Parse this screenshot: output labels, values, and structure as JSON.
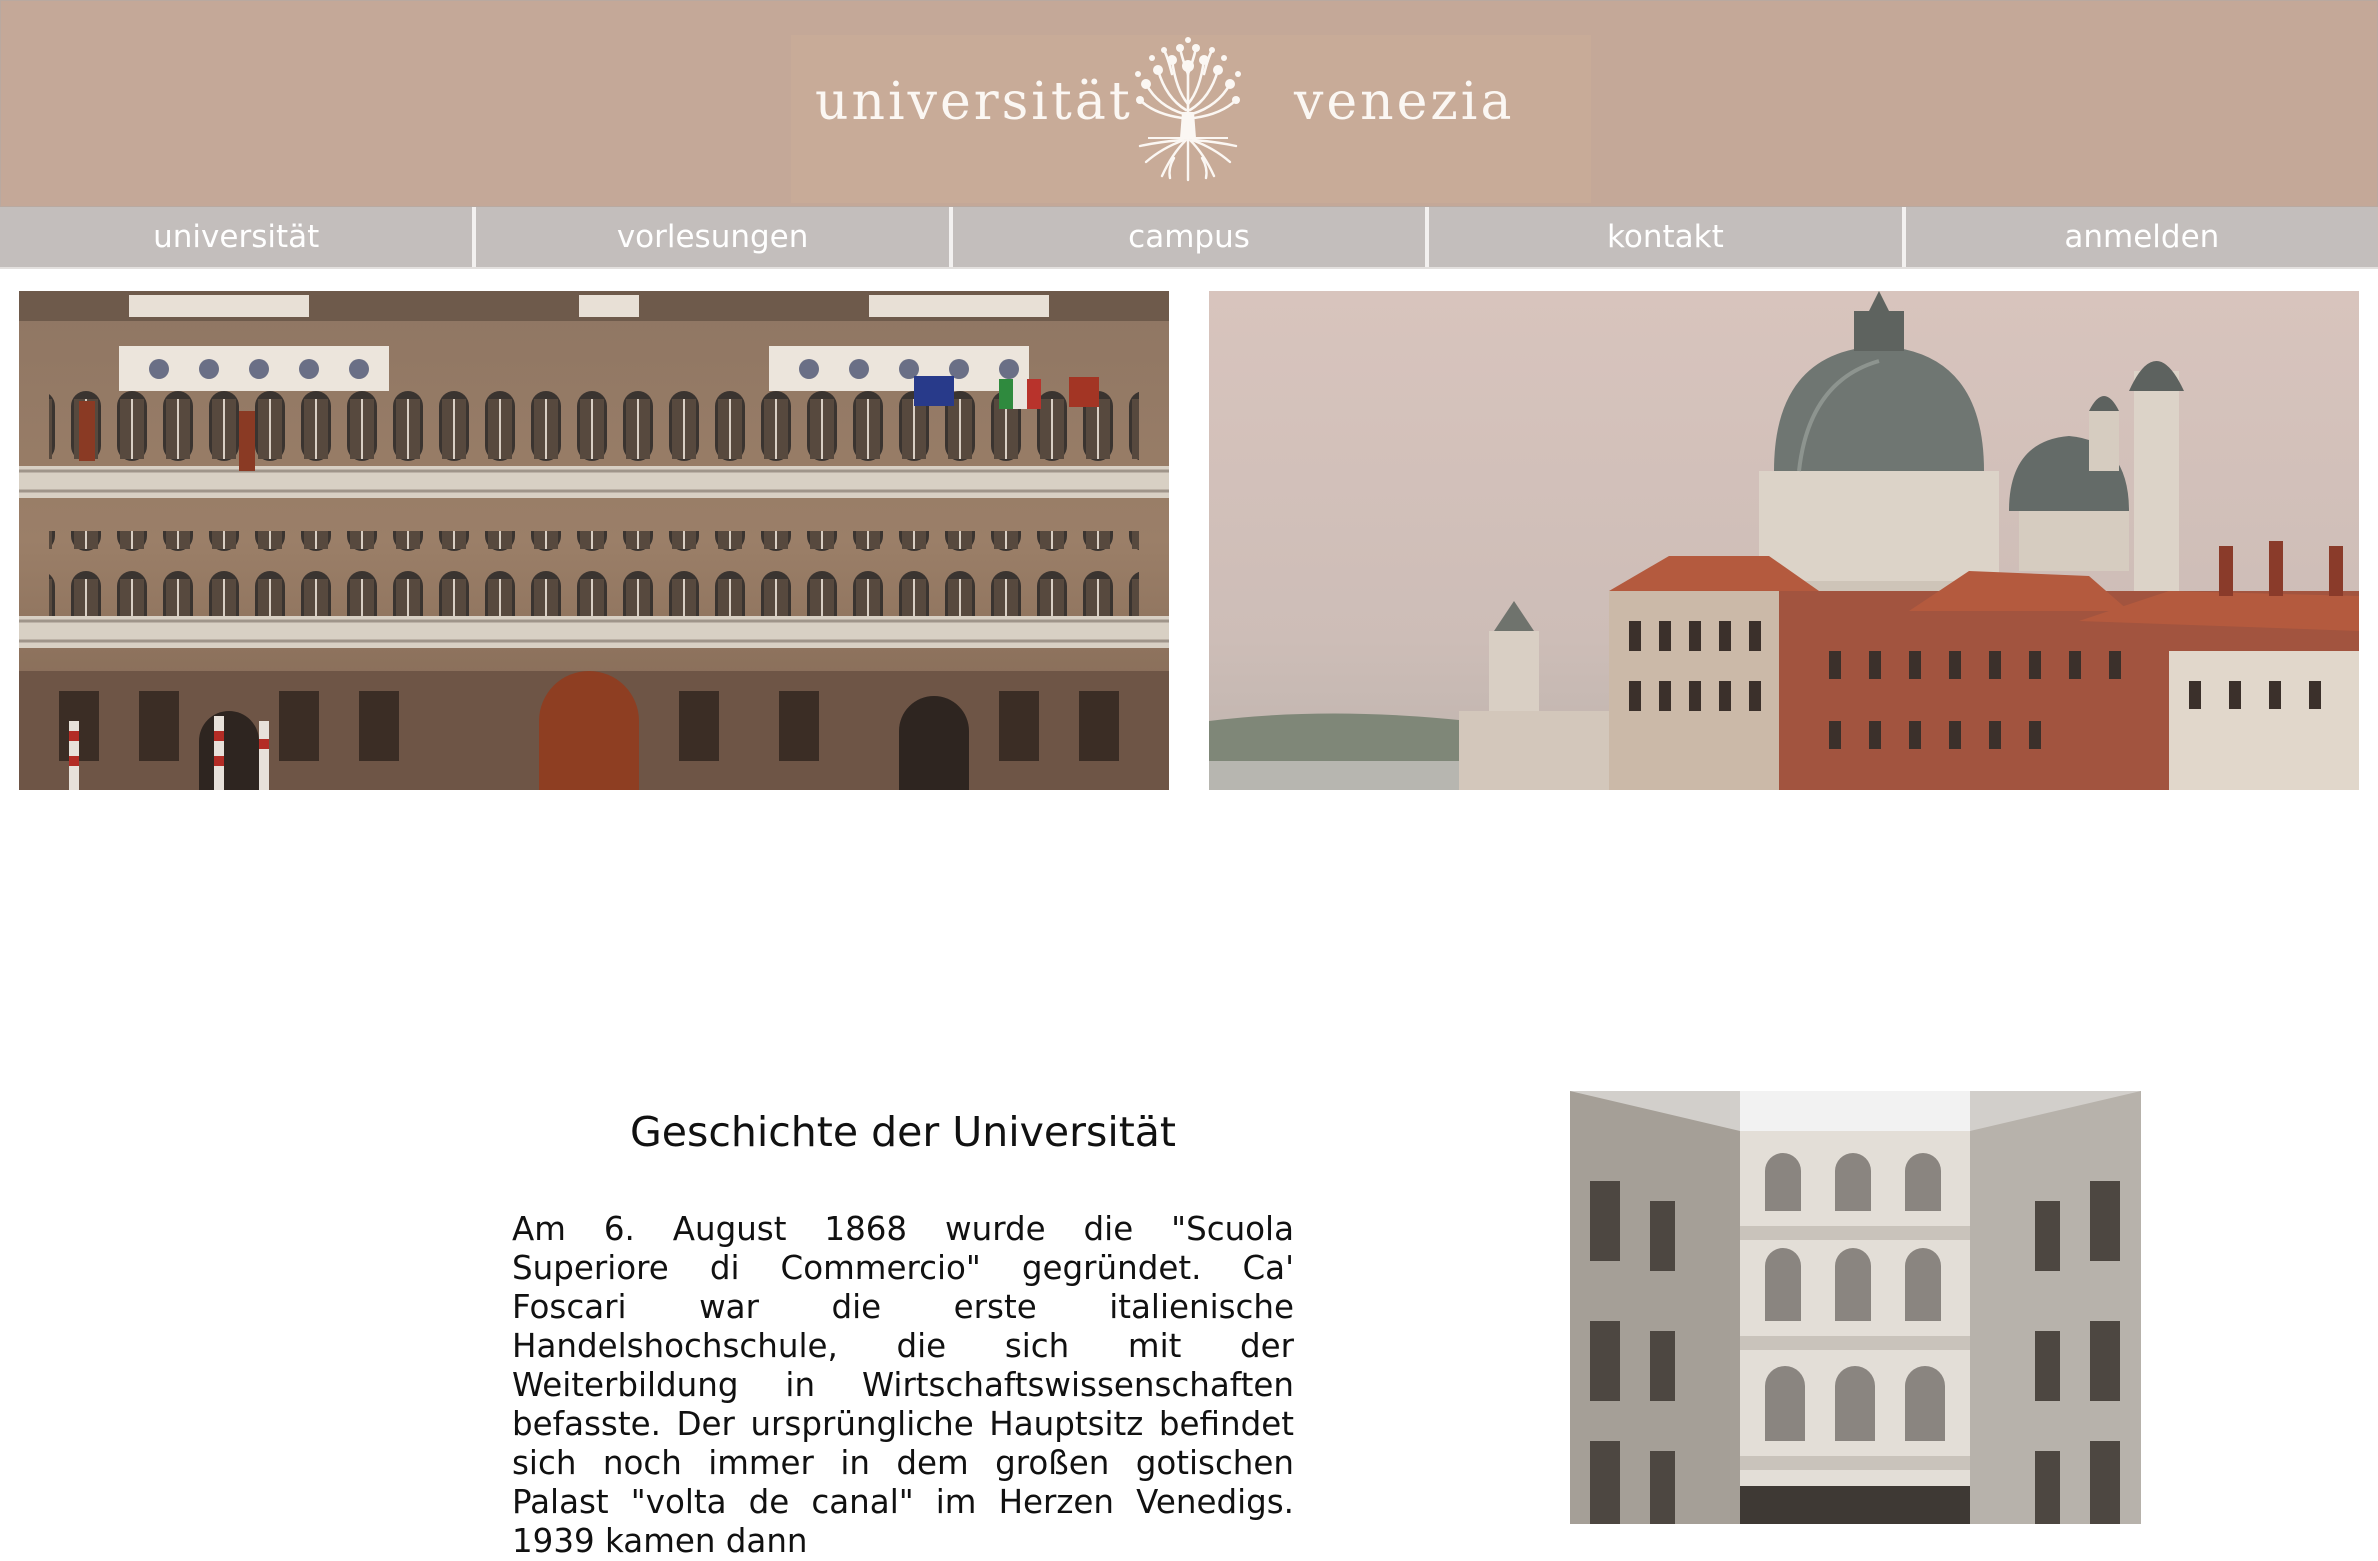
{
  "header": {
    "logo_left": "universität",
    "logo_right": "venezia",
    "logo_icon": "tree-icon"
  },
  "nav": {
    "items": [
      {
        "label": "universität"
      },
      {
        "label": "vorlesungen"
      },
      {
        "label": "campus"
      },
      {
        "label": "kontakt"
      },
      {
        "label": "anmelden"
      }
    ]
  },
  "hero": {
    "left_image": "palazzo-facade-photo",
    "right_image": "santa-maria-della-salute-photo"
  },
  "history": {
    "title": "Geschichte der Universität",
    "text": "Am 6. August 1868 wurde die \"Scuola Superiore di Commercio\" gegründet. Ca' Foscari war die erste italienische Handelshochschule, die sich mit der Weiterbildung in Wirtschaftswissenschaften befasste. Der ursprüngliche Hauptsitz befindet sich noch immer in dem großen gotischen Palast \"volta de canal\" im Herzen Venedigs. 1939 kamen dann",
    "image": "courtyard-photo"
  },
  "colors": {
    "header_bg": "#c4a898",
    "nav_bg": "#c3bebc",
    "nav_text": "#ffffff",
    "logo_text": "#fbf7f3"
  }
}
